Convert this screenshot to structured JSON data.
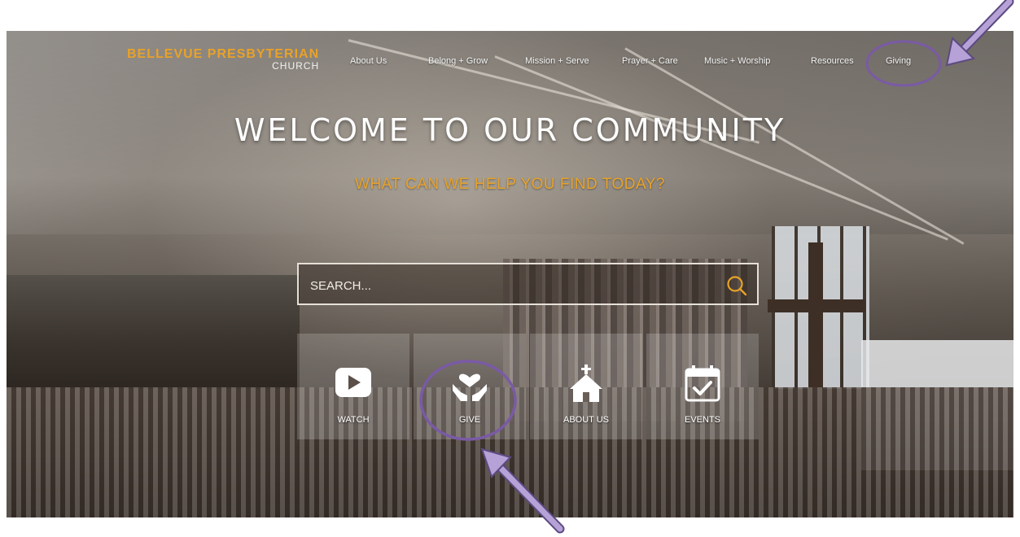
{
  "logo": {
    "main": "BELLEVUE PRESBYTERIAN",
    "sub": "CHURCH"
  },
  "nav": {
    "items": [
      {
        "label": "About Us"
      },
      {
        "label": "Belong + Grow"
      },
      {
        "label": "Mission + Serve"
      },
      {
        "label": "Prayer + Care"
      },
      {
        "label": "Music + Worship"
      },
      {
        "label": "Resources"
      },
      {
        "label": "Giving"
      }
    ]
  },
  "hero": {
    "title": "WELCOME TO OUR COMMUNITY",
    "subtitle": "WHAT CAN WE HELP YOU FIND TODAY?"
  },
  "search": {
    "placeholder": "SEARCH..."
  },
  "tiles": [
    {
      "label": "WATCH",
      "icon": "play-icon"
    },
    {
      "label": "GIVE",
      "icon": "hands-heart-icon"
    },
    {
      "label": "ABOUT US",
      "icon": "church-icon"
    },
    {
      "label": "EVENTS",
      "icon": "calendar-check-icon"
    }
  ],
  "colors": {
    "accent": "#e8a229",
    "annotation": "#7a5aa6"
  }
}
